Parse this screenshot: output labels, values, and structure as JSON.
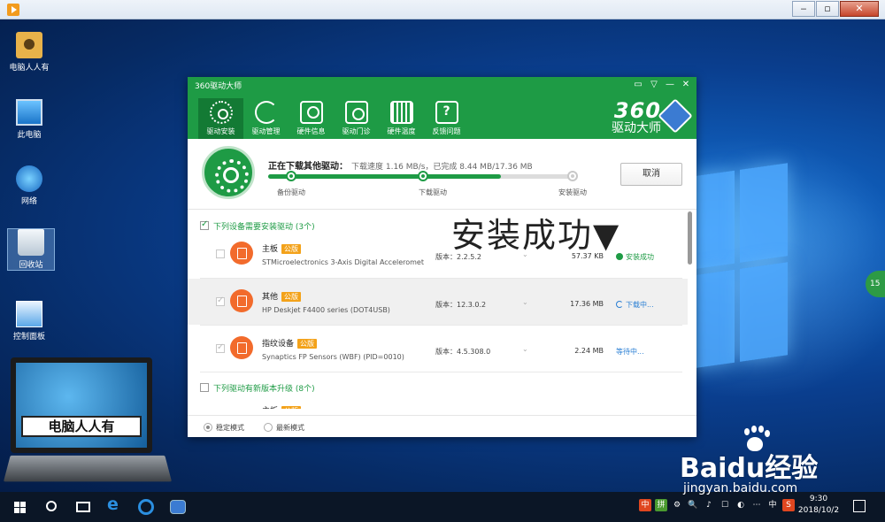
{
  "desktop": {
    "icons": [
      {
        "label": "电脑人人有"
      },
      {
        "label": "此电脑"
      },
      {
        "label": "网络"
      },
      {
        "label": "回收站"
      },
      {
        "label": "控制面板"
      }
    ],
    "laptop_badge": "电脑人人有",
    "side_bubble": "15"
  },
  "app": {
    "title": "360驱动大师",
    "window_controls": [
      "▭",
      "▽",
      "—",
      "✕"
    ],
    "nav": [
      {
        "label": "驱动安装",
        "icon": "gear-icon",
        "active": true
      },
      {
        "label": "驱动管理",
        "icon": "refresh-icon"
      },
      {
        "label": "硬件信息",
        "icon": "monitor-icon"
      },
      {
        "label": "驱动门诊",
        "icon": "clinic-icon"
      },
      {
        "label": "硬件温度",
        "icon": "thermometer-icon"
      },
      {
        "label": "反馈问题",
        "icon": "feedback-icon"
      }
    ],
    "brand": {
      "big": "360",
      "small": "驱动大师"
    },
    "progress": {
      "status": "正在下载其他驱动：",
      "detail": "下载速度 1.16 MB/s，已完成 8.44 MB/17.36 MB",
      "fraction": 0.75,
      "steps": [
        "备份驱动",
        "下载驱动",
        "安装驱动"
      ],
      "cancel": "取消"
    },
    "section1": "下列设备需要安装驱动 (3个)",
    "section2": "下列驱动有新版本升级 (8个)",
    "overlay": "安装成功▼",
    "drivers": [
      {
        "category": "主板",
        "tag": "公版",
        "name": "STMicroelectronics 3-Axis Digital Acceleromet",
        "version": "版本：2.2.5.2",
        "size": "57.37 KB",
        "status": "安装成功",
        "status_type": "ok"
      },
      {
        "category": "其他",
        "tag": "公版",
        "name": "HP Deskjet F4400 series (DOT4USB)",
        "version": "版本：12.3.0.2",
        "size": "17.36 MB",
        "status": "下载中...",
        "status_type": "dl"
      },
      {
        "category": "指纹设备",
        "tag": "公版",
        "name": "Synaptics FP Sensors (WBF) (PID=0010)",
        "version": "版本：4.5.308.0",
        "size": "2.24 MB",
        "status": "等待中...",
        "status_type": "wait"
      }
    ],
    "upgrade_preview": {
      "category": "主板",
      "tag": "公版"
    },
    "footer": {
      "mode1": "稳定模式",
      "mode2": "最新模式"
    }
  },
  "taskbar": {
    "tray": [
      "中",
      "拼",
      "⚙",
      "🔍",
      "♪",
      "☐",
      "◐",
      "⋯",
      "中",
      "S"
    ],
    "time": "9:30",
    "date": "2018/10/2"
  },
  "watermark": {
    "main": "Baidu经验",
    "url": "jingyan.baidu.com"
  }
}
